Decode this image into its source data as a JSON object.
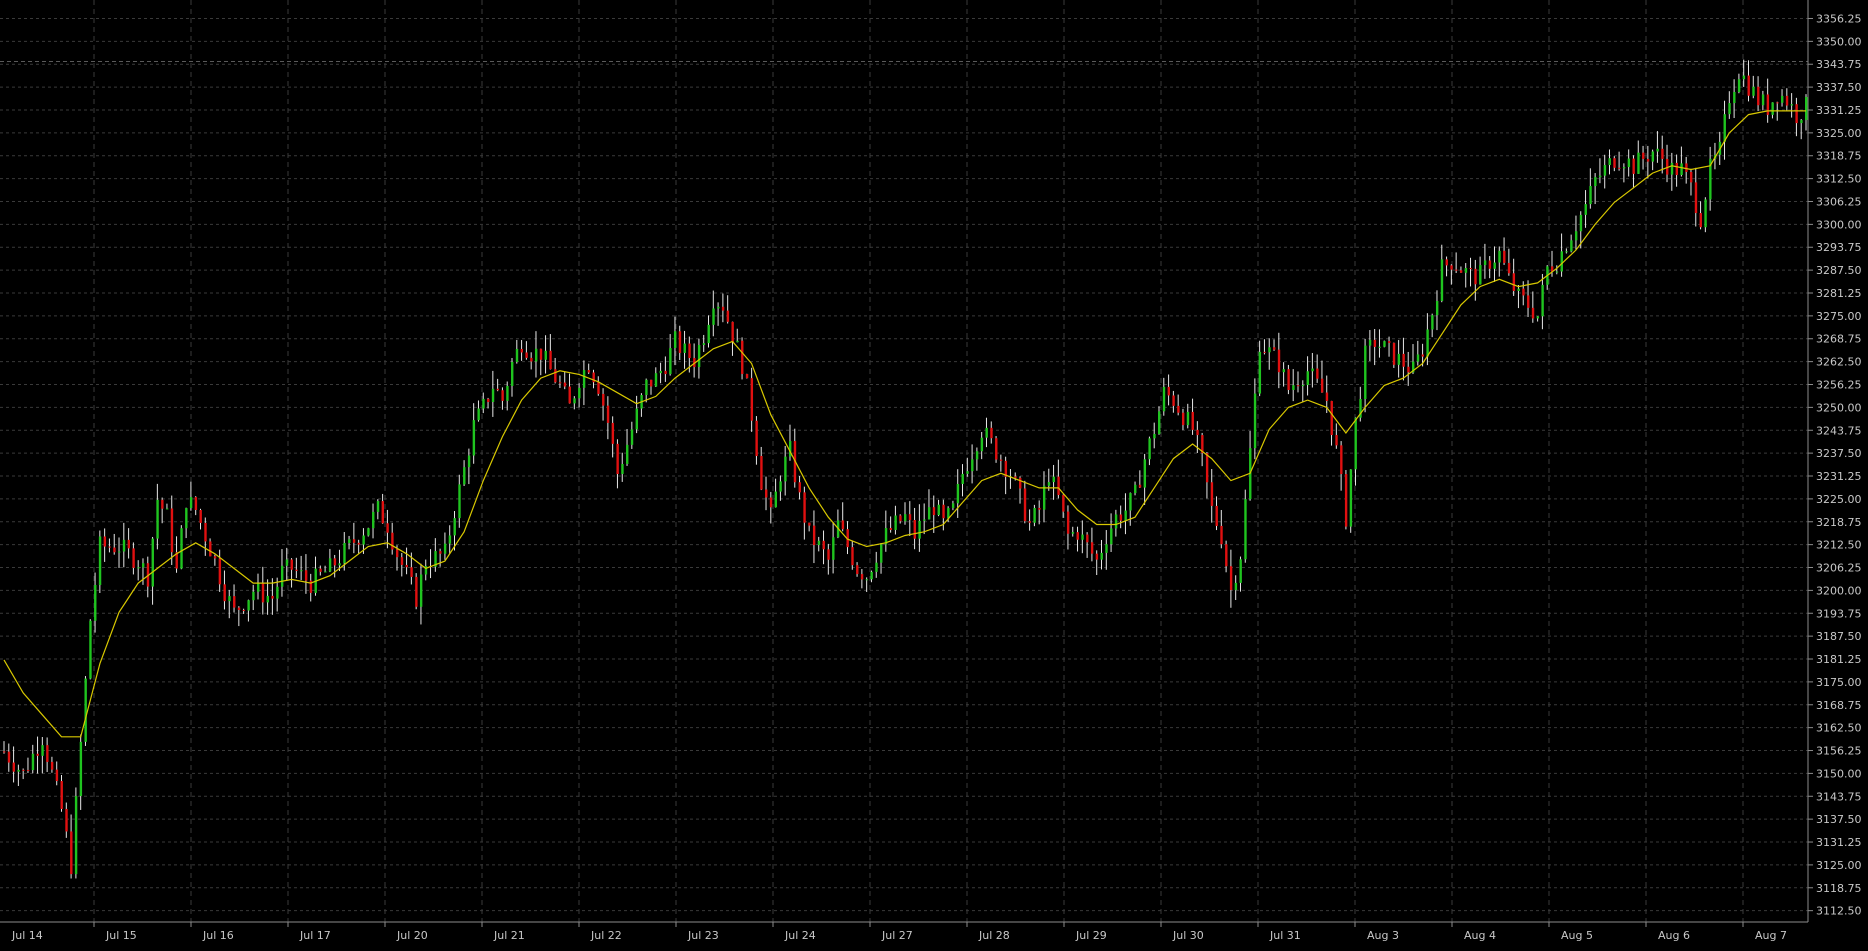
{
  "colors": {
    "background": "#000000",
    "grid": "#3a3a3a",
    "axis": "#8c8c8c",
    "text": "#c8c8c8",
    "up": "#1fc41f",
    "down": "#e01010",
    "wick": "#e8e8e8",
    "ma": "#d8c800"
  },
  "chart_data": {
    "type": "candlestick",
    "ylim": [
      3109.4,
      3361.3
    ],
    "y_ticks": [
      "3356.25",
      "3350.00",
      "3343.75",
      "3337.50",
      "3331.25",
      "3325.00",
      "3318.75",
      "3312.50",
      "3306.25",
      "3300.00",
      "3293.75",
      "3287.50",
      "3281.25",
      "3275.00",
      "3268.75",
      "3262.50",
      "3256.25",
      "3250.00",
      "3243.75",
      "3237.50",
      "3231.25",
      "3225.00",
      "3218.75",
      "3212.50",
      "3206.25",
      "3200.00",
      "3193.75",
      "3187.50",
      "3181.25",
      "3175.00",
      "3168.75",
      "3162.50",
      "3156.25",
      "3150.00",
      "3143.75",
      "3137.50",
      "3131.25",
      "3125.00",
      "3118.75",
      "3112.50"
    ],
    "x_labels": [
      "Jul 14",
      "Jul 15",
      "Jul 16",
      "Jul 17",
      "Jul 20",
      "Jul 21",
      "Jul 22",
      "Jul 23",
      "Jul 24",
      "Jul 27",
      "Jul 28",
      "Jul 29",
      "Jul 30",
      "Jul 31",
      "Aug 3",
      "Aug 4",
      "Aug 5",
      "Aug 6",
      "Aug 7"
    ],
    "reference_level": 3344.5,
    "close_series": [
      [
        0,
        3156
      ],
      [
        2,
        3150
      ],
      [
        4,
        3160
      ],
      [
        6,
        3140
      ],
      [
        7,
        3125
      ],
      [
        8,
        3158
      ],
      [
        9,
        3192
      ],
      [
        10,
        3212
      ],
      [
        12,
        3212
      ],
      [
        14,
        3208
      ],
      [
        15,
        3204
      ],
      [
        16,
        3225
      ],
      [
        17,
        3220
      ],
      [
        18,
        3205
      ],
      [
        19,
        3225
      ],
      [
        20,
        3222
      ],
      [
        21,
        3215
      ],
      [
        22,
        3208
      ],
      [
        23,
        3200
      ],
      [
        24,
        3194
      ],
      [
        26,
        3200
      ],
      [
        28,
        3198
      ],
      [
        29,
        3205
      ],
      [
        30,
        3206
      ],
      [
        32,
        3202
      ],
      [
        34,
        3206
      ],
      [
        36,
        3212
      ],
      [
        38,
        3218
      ],
      [
        39,
        3222
      ],
      [
        40,
        3218
      ],
      [
        41,
        3210
      ],
      [
        42,
        3204
      ],
      [
        43,
        3198
      ],
      [
        44,
        3208
      ],
      [
        46,
        3210
      ],
      [
        47,
        3222
      ],
      [
        48,
        3233
      ],
      [
        49,
        3245
      ],
      [
        50,
        3250
      ],
      [
        51,
        3256
      ],
      [
        52,
        3252
      ],
      [
        53,
        3262
      ],
      [
        54,
        3268
      ],
      [
        55,
        3265
      ],
      [
        56,
        3265
      ],
      [
        57,
        3260
      ],
      [
        58,
        3256
      ],
      [
        59,
        3250
      ],
      [
        60,
        3258
      ],
      [
        61,
        3262
      ],
      [
        62,
        3256
      ],
      [
        63,
        3246
      ],
      [
        64,
        3232
      ],
      [
        65,
        3240
      ],
      [
        66,
        3248
      ],
      [
        67,
        3256
      ],
      [
        68,
        3258
      ],
      [
        69,
        3262
      ],
      [
        70,
        3268
      ],
      [
        71,
        3265
      ],
      [
        72,
        3263
      ],
      [
        73,
        3270
      ],
      [
        74,
        3280
      ],
      [
        75,
        3278
      ],
      [
        76,
        3270
      ],
      [
        77,
        3262
      ],
      [
        78,
        3248
      ],
      [
        79,
        3230
      ],
      [
        80,
        3220
      ],
      [
        81,
        3232
      ],
      [
        82,
        3238
      ],
      [
        83,
        3225
      ],
      [
        84,
        3215
      ],
      [
        85,
        3212
      ],
      [
        86,
        3208
      ],
      [
        87,
        3218
      ],
      [
        88,
        3212
      ],
      [
        89,
        3206
      ],
      [
        90,
        3204
      ],
      [
        91,
        3210
      ],
      [
        92,
        3215
      ],
      [
        93,
        3218
      ],
      [
        94,
        3220
      ],
      [
        95,
        3215
      ],
      [
        96,
        3220
      ],
      [
        97,
        3223
      ],
      [
        98,
        3218
      ],
      [
        99,
        3222
      ],
      [
        100,
        3232
      ],
      [
        101,
        3238
      ],
      [
        102,
        3244
      ],
      [
        103,
        3240
      ],
      [
        104,
        3236
      ],
      [
        105,
        3232
      ],
      [
        106,
        3225
      ],
      [
        107,
        3218
      ],
      [
        108,
        3222
      ],
      [
        109,
        3232
      ],
      [
        110,
        3225
      ],
      [
        111,
        3215
      ],
      [
        112,
        3216
      ],
      [
        113,
        3212
      ],
      [
        114,
        3208
      ],
      [
        115,
        3215
      ],
      [
        116,
        3220
      ],
      [
        117,
        3222
      ],
      [
        118,
        3226
      ],
      [
        119,
        3236
      ],
      [
        120,
        3244
      ],
      [
        121,
        3254
      ],
      [
        122,
        3252
      ],
      [
        123,
        3248
      ],
      [
        124,
        3244
      ],
      [
        125,
        3235
      ],
      [
        126,
        3222
      ],
      [
        127,
        3215
      ],
      [
        128,
        3200
      ],
      [
        129,
        3210
      ],
      [
        130,
        3238
      ],
      [
        131,
        3268
      ],
      [
        132,
        3265
      ],
      [
        133,
        3262
      ],
      [
        134,
        3255
      ],
      [
        135,
        3258
      ],
      [
        136,
        3260
      ],
      [
        137,
        3256
      ],
      [
        138,
        3252
      ],
      [
        139,
        3238
      ],
      [
        140,
        3220
      ],
      [
        141,
        3246
      ],
      [
        142,
        3264
      ],
      [
        143,
        3268
      ],
      [
        144,
        3266
      ],
      [
        145,
        3264
      ],
      [
        146,
        3262
      ],
      [
        147,
        3260
      ],
      [
        148,
        3266
      ],
      [
        149,
        3276
      ],
      [
        150,
        3288
      ],
      [
        151,
        3290
      ],
      [
        152,
        3288
      ],
      [
        153,
        3286
      ],
      [
        154,
        3286
      ],
      [
        155,
        3290
      ],
      [
        156,
        3292
      ],
      [
        157,
        3285
      ],
      [
        158,
        3280
      ],
      [
        159,
        3278
      ],
      [
        160,
        3275
      ],
      [
        161,
        3288
      ],
      [
        162,
        3290
      ],
      [
        163,
        3295
      ],
      [
        164,
        3300
      ],
      [
        165,
        3305
      ],
      [
        166,
        3312
      ],
      [
        167,
        3315
      ],
      [
        168,
        3318
      ],
      [
        169,
        3318
      ],
      [
        170,
        3316
      ],
      [
        171,
        3318
      ],
      [
        172,
        3320
      ],
      [
        173,
        3318
      ],
      [
        174,
        3315
      ],
      [
        175,
        3315
      ],
      [
        176,
        3310
      ],
      [
        177,
        3302
      ],
      [
        178,
        3315
      ],
      [
        179,
        3320
      ],
      [
        180,
        3335
      ],
      [
        181,
        3342
      ],
      [
        182,
        3338
      ],
      [
        183,
        3334
      ],
      [
        184,
        3332
      ],
      [
        185,
        3336
      ],
      [
        186,
        3334
      ],
      [
        187,
        3330
      ],
      [
        188,
        3332
      ]
    ],
    "moving_average": [
      [
        0,
        3181
      ],
      [
        2,
        3172
      ],
      [
        4,
        3166
      ],
      [
        6,
        3160
      ],
      [
        8,
        3160
      ],
      [
        10,
        3180
      ],
      [
        12,
        3194
      ],
      [
        14,
        3202
      ],
      [
        16,
        3206
      ],
      [
        18,
        3210
      ],
      [
        20,
        3213
      ],
      [
        22,
        3210
      ],
      [
        24,
        3206
      ],
      [
        26,
        3202
      ],
      [
        28,
        3202
      ],
      [
        30,
        3203
      ],
      [
        32,
        3202
      ],
      [
        34,
        3204
      ],
      [
        36,
        3208
      ],
      [
        38,
        3212
      ],
      [
        40,
        3213
      ],
      [
        42,
        3210
      ],
      [
        44,
        3206
      ],
      [
        46,
        3208
      ],
      [
        48,
        3216
      ],
      [
        50,
        3230
      ],
      [
        52,
        3242
      ],
      [
        54,
        3252
      ],
      [
        56,
        3258
      ],
      [
        58,
        3260
      ],
      [
        60,
        3259
      ],
      [
        62,
        3257
      ],
      [
        64,
        3254
      ],
      [
        66,
        3251
      ],
      [
        68,
        3253
      ],
      [
        70,
        3258
      ],
      [
        72,
        3262
      ],
      [
        74,
        3266
      ],
      [
        76,
        3268
      ],
      [
        78,
        3262
      ],
      [
        80,
        3248
      ],
      [
        82,
        3238
      ],
      [
        84,
        3228
      ],
      [
        86,
        3220
      ],
      [
        88,
        3214
      ],
      [
        90,
        3212
      ],
      [
        92,
        3213
      ],
      [
        94,
        3215
      ],
      [
        96,
        3216
      ],
      [
        98,
        3218
      ],
      [
        100,
        3224
      ],
      [
        102,
        3230
      ],
      [
        104,
        3232
      ],
      [
        106,
        3230
      ],
      [
        108,
        3228
      ],
      [
        110,
        3228
      ],
      [
        112,
        3222
      ],
      [
        114,
        3218
      ],
      [
        116,
        3218
      ],
      [
        118,
        3220
      ],
      [
        120,
        3228
      ],
      [
        122,
        3236
      ],
      [
        124,
        3240
      ],
      [
        126,
        3236
      ],
      [
        128,
        3230
      ],
      [
        130,
        3232
      ],
      [
        132,
        3244
      ],
      [
        134,
        3250
      ],
      [
        136,
        3252
      ],
      [
        138,
        3250
      ],
      [
        140,
        3243
      ],
      [
        142,
        3250
      ],
      [
        144,
        3256
      ],
      [
        146,
        3258
      ],
      [
        148,
        3262
      ],
      [
        150,
        3270
      ],
      [
        152,
        3278
      ],
      [
        154,
        3283
      ],
      [
        156,
        3285
      ],
      [
        158,
        3283
      ],
      [
        160,
        3284
      ],
      [
        162,
        3288
      ],
      [
        164,
        3293
      ],
      [
        166,
        3300
      ],
      [
        168,
        3306
      ],
      [
        170,
        3310
      ],
      [
        172,
        3314
      ],
      [
        174,
        3316
      ],
      [
        176,
        3315
      ],
      [
        178,
        3316
      ],
      [
        180,
        3325
      ],
      [
        182,
        3330
      ],
      [
        184,
        3331
      ],
      [
        186,
        3331
      ],
      [
        188,
        3331
      ]
    ]
  }
}
